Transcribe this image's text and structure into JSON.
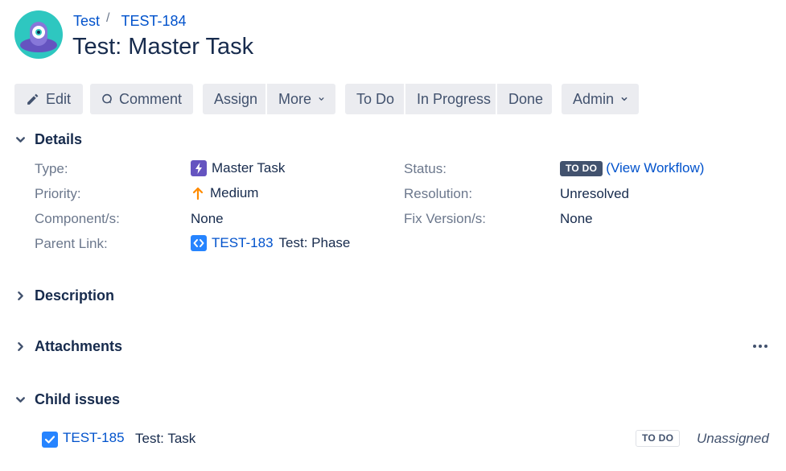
{
  "breadcrumb": {
    "project": "Test",
    "separator": "/",
    "issue_key": "TEST-184"
  },
  "issue": {
    "title": "Test: Master Task"
  },
  "toolbar": {
    "edit": "Edit",
    "comment": "Comment",
    "assign": "Assign",
    "more": "More",
    "todo": "To Do",
    "in_progress": "In Progress",
    "done": "Done",
    "admin": "Admin"
  },
  "details": {
    "heading": "Details",
    "type_label": "Type:",
    "type_value": "Master Task",
    "priority_label": "Priority:",
    "priority_value": "Medium",
    "component_label": "Component/s:",
    "component_value": "None",
    "parent_label": "Parent Link:",
    "parent_key": "TEST-183",
    "parent_summary": "Test: Phase",
    "status_label": "Status:",
    "status_value": "TO DO",
    "view_workflow": "(View Workflow)",
    "resolution_label": "Resolution:",
    "resolution_value": "Unresolved",
    "fix_version_label": "Fix Version/s:",
    "fix_version_value": "None"
  },
  "sections": {
    "description": "Description",
    "attachments": "Attachments",
    "child_issues": "Child issues"
  },
  "child_issues": [
    {
      "key": "TEST-185",
      "summary": "Test: Task",
      "status": "TO DO",
      "assignee": "Unassigned"
    }
  ],
  "icons": {
    "avatar": "project-avatar-icon",
    "edit": "pencil-icon",
    "comment": "comment-icon",
    "dropdown": "chevron-down-icon",
    "section_open": "chevron-down-icon",
    "section_closed": "chevron-right-icon",
    "type": "master-task-icon",
    "priority": "arrow-up-icon",
    "parent": "epic-link-icon",
    "more": "ellipsis-icon",
    "checkbox": "checkbox-checked-icon"
  },
  "colors": {
    "link": "#0052cc",
    "text": "#172b4d",
    "muted": "#6b778c",
    "button_bg": "#ebecf0",
    "priority_medium": "#ff8b00",
    "type_icon": "#6554c0",
    "parent_icon": "#2684ff",
    "status_todo": "#42526e"
  }
}
